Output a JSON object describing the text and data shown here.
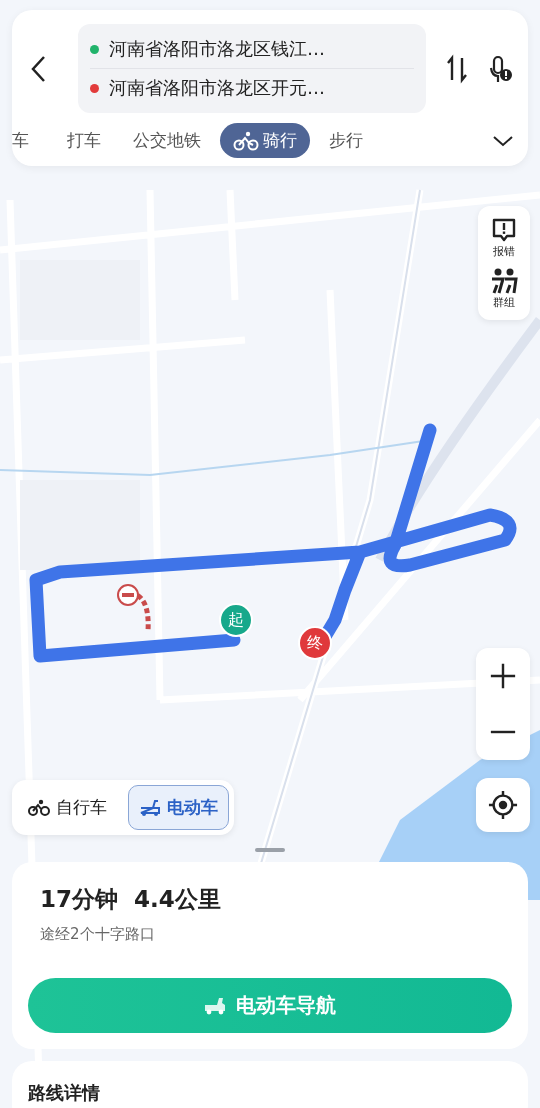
{
  "origin": "河南省洛阳市洛龙区钱江…",
  "destination": "河南省洛阳市洛龙区开元…",
  "mode_tabs": [
    {
      "label": "车",
      "selected": false
    },
    {
      "label": "打车",
      "selected": false
    },
    {
      "label": "公交地铁",
      "selected": false
    },
    {
      "label": "骑行",
      "selected": true
    },
    {
      "label": "步行",
      "selected": false
    }
  ],
  "map_tools": [
    {
      "label": "报错",
      "kind": "report"
    },
    {
      "label": "群组",
      "kind": "group"
    }
  ],
  "markers": {
    "start": "起",
    "end": "终"
  },
  "vehicle_toggle": [
    {
      "label": "自行车",
      "kind": "bicycle",
      "selected": false
    },
    {
      "label": "电动车",
      "kind": "scooter",
      "selected": true
    }
  ],
  "summary": {
    "duration": "17分钟",
    "distance": "4.4公里",
    "note": "途经2个十字路口"
  },
  "navigate_button": "电动车导航",
  "details_title": "路线详情"
}
